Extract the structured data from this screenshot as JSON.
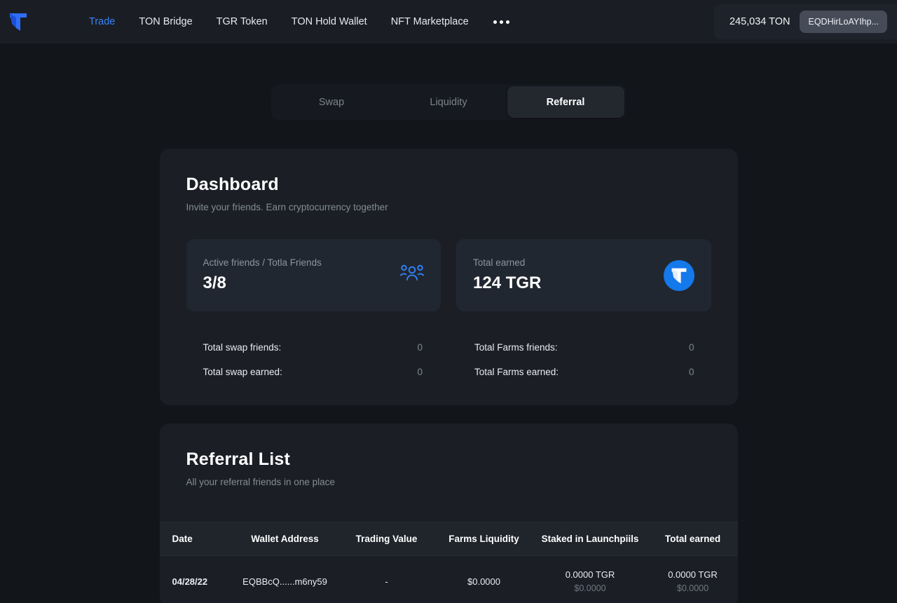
{
  "header": {
    "logo_icon": "ton-t-logo-icon",
    "nav": [
      {
        "label": "Trade",
        "active": true
      },
      {
        "label": "TON Bridge",
        "active": false
      },
      {
        "label": "TGR Token",
        "active": false
      },
      {
        "label": "TON Hold Wallet",
        "active": false
      },
      {
        "label": "NFT Marketplace",
        "active": false
      }
    ],
    "more_icon": "ellipsis-icon",
    "wallet": {
      "balance": "245,034 TON",
      "address": "EQDHirLoAYIhp..."
    }
  },
  "tabs": [
    {
      "label": "Swap",
      "active": false
    },
    {
      "label": "Liquidity",
      "active": false
    },
    {
      "label": "Referral",
      "active": true
    }
  ],
  "dashboard": {
    "title": "Dashboard",
    "subtitle": "Invite your friends. Earn cryptocurrency together",
    "cards": [
      {
        "label": "Active friends / Totla Friends",
        "value": "3/8",
        "icon": "people-group-icon"
      },
      {
        "label": "Total earned",
        "value": "124 TGR",
        "icon": "tgr-token-icon"
      }
    ],
    "stats": [
      {
        "key": "Total swap friends:",
        "value": "0"
      },
      {
        "key": "Total Farms friends:",
        "value": "0"
      },
      {
        "key": "Total swap earned:",
        "value": "0"
      },
      {
        "key": "Total Farms earned:",
        "value": "0"
      }
    ]
  },
  "referral": {
    "title": "Referral List",
    "subtitle": "All your referral friends in one place",
    "columns": [
      "Date",
      "Wallet Address",
      "Trading Value",
      "Farms Liquidity",
      "Staked in Launchpiils",
      "Total earned"
    ],
    "rows": [
      {
        "date": "04/28/22",
        "address": "EQBBcQ......m6ny59",
        "trading_value": "-",
        "farms_liquidity": "$0.0000",
        "staked_tgr": "0.0000 TGR",
        "staked_usd": "$0.0000",
        "earned_tgr": "0.0000 TGR",
        "earned_usd": "$0.0000"
      }
    ]
  },
  "colors": {
    "page_bg": "#121519",
    "panel_bg": "#1b1f25",
    "card_bg": "#212730",
    "accent": "#3b82f6",
    "token_blue": "#1479ea",
    "muted_text": "#848b96"
  }
}
